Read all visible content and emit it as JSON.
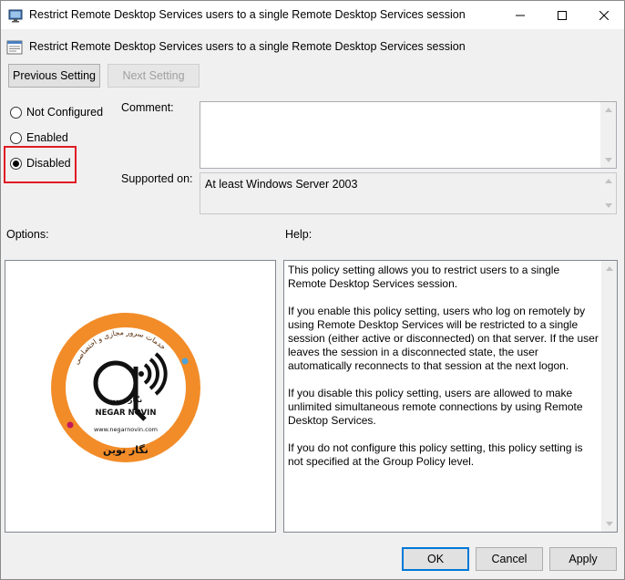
{
  "window": {
    "title": "Restrict Remote Desktop Services users to a single Remote Desktop Services session",
    "minimize_icon": "minimize-icon",
    "maximize_icon": "maximize-icon",
    "close_icon": "close-icon"
  },
  "header": {
    "title": "Restrict Remote Desktop Services users to a single Remote Desktop Services session"
  },
  "nav": {
    "previous_label": "Previous Setting",
    "next_label": "Next Setting"
  },
  "state": {
    "options": [
      {
        "label": "Not Configured",
        "checked": false
      },
      {
        "label": "Enabled",
        "checked": false
      },
      {
        "label": "Disabled",
        "checked": true
      }
    ],
    "highlight_color": "#e01b24"
  },
  "comment": {
    "label": "Comment:",
    "value": ""
  },
  "supported": {
    "label": "Supported on:",
    "value": "At least Windows Server 2003"
  },
  "options_section": {
    "label": "Options:",
    "logo": {
      "brand_latin": "NEGAR NOVIN",
      "url": "www.negarnovin.com",
      "brand_arabic": "نگار نوین",
      "ring_color": "#f28c28"
    }
  },
  "help_section": {
    "label": "Help:",
    "paragraphs": [
      "This policy setting allows you to restrict users to a single Remote Desktop Services session.",
      "If you enable this policy setting, users who log on remotely by using Remote Desktop Services will be restricted to a single session (either active or disconnected) on that server. If the user leaves the session in a disconnected state, the user automatically reconnects to that session at the next logon.",
      "If you disable this policy setting, users are allowed to make unlimited simultaneous remote connections by using Remote Desktop Services.",
      "If you do not configure this policy setting,  this policy setting is not specified at the Group Policy level."
    ]
  },
  "footer": {
    "ok_label": "OK",
    "cancel_label": "Cancel",
    "apply_label": "Apply"
  },
  "colors": {
    "accent": "#0078d7",
    "background": "#f0f0f0"
  }
}
